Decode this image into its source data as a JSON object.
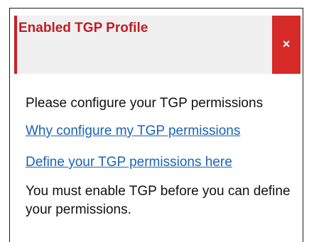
{
  "alert": {
    "title": "Enabled TGP Profile",
    "close_glyph": "×",
    "close_icon": "close-icon",
    "accent_color": "#c8202a",
    "close_bg_color": "#d52a27",
    "title_color": "#c01b24"
  },
  "body": {
    "intro": "Please configure your TGP permissions",
    "link_why": "Why configure my TGP permissions",
    "link_define": "Define your TGP permissions here",
    "note": "You must enable TGP before you can define your permissions.",
    "link_color": "#1a62b5"
  }
}
